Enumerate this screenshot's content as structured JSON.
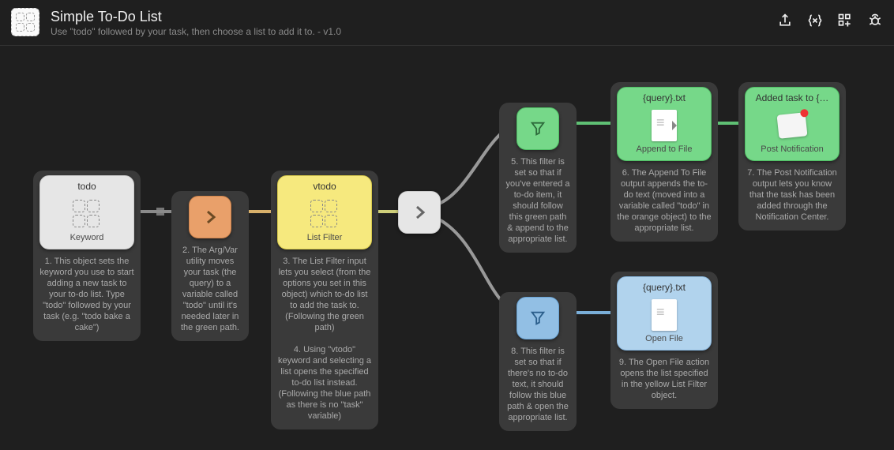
{
  "header": {
    "title": "Simple To-Do List",
    "subtitle": "Use \"todo\" followed by your task, then choose a list to add it to. - v1.0"
  },
  "nodes": {
    "keyword": {
      "title": "todo",
      "label": "Keyword",
      "caption": "1. This object sets the keyword you use to start adding a new task to your to-do list. Type \"todo\" followed by your task (e.g. \"todo bake a cake\")"
    },
    "argvar": {
      "caption": "2. The Arg/Var utility moves your task (the query) to a variable called \"todo\" until it's needed later in the green path."
    },
    "listfilter": {
      "title": "vtodo",
      "label": "List Filter",
      "caption": "3. The List Filter input lets you select (from the options you set in this object) which to-do list to add the task to. (Following the green path)\n\n4. Using \"vtodo\" keyword and selecting a list opens the specified to-do list instead. (Following the blue path as there is no \"task\" variable)"
    },
    "filter_green": {
      "caption": "5. This filter is set so that if you've entered a to-do item, it should follow this green path & append to the appropriate list."
    },
    "append_file": {
      "title": "{query}.txt",
      "label": "Append to File",
      "caption": "6. The Append To File output appends the to-do text (moved into a variable called \"todo\" in the orange object) to the appropriate list."
    },
    "post_notif": {
      "title": "Added task to {…",
      "label": "Post Notification",
      "caption": "7. The Post Notification output lets you know that the task has been added through the Notification Center."
    },
    "filter_blue": {
      "caption": "8. This filter is set so that if there's no to-do text, it should follow this blue path & open the appropriate list."
    },
    "open_file": {
      "title": "{query}.txt",
      "label": "Open File",
      "caption": "9. The Open File action opens the list specified in the yellow List Filter object."
    }
  },
  "icons": {
    "share": "share-icon",
    "vars": "braces-x-icon",
    "add": "grid-plus-icon",
    "debug": "bug-icon"
  },
  "colors": {
    "canvas": "#1f1f1f",
    "green": "#76d889",
    "yellow": "#f6e97e",
    "orange": "#e9a06a",
    "grey": "#e6e6e6",
    "blue": "#b1d3ed"
  }
}
